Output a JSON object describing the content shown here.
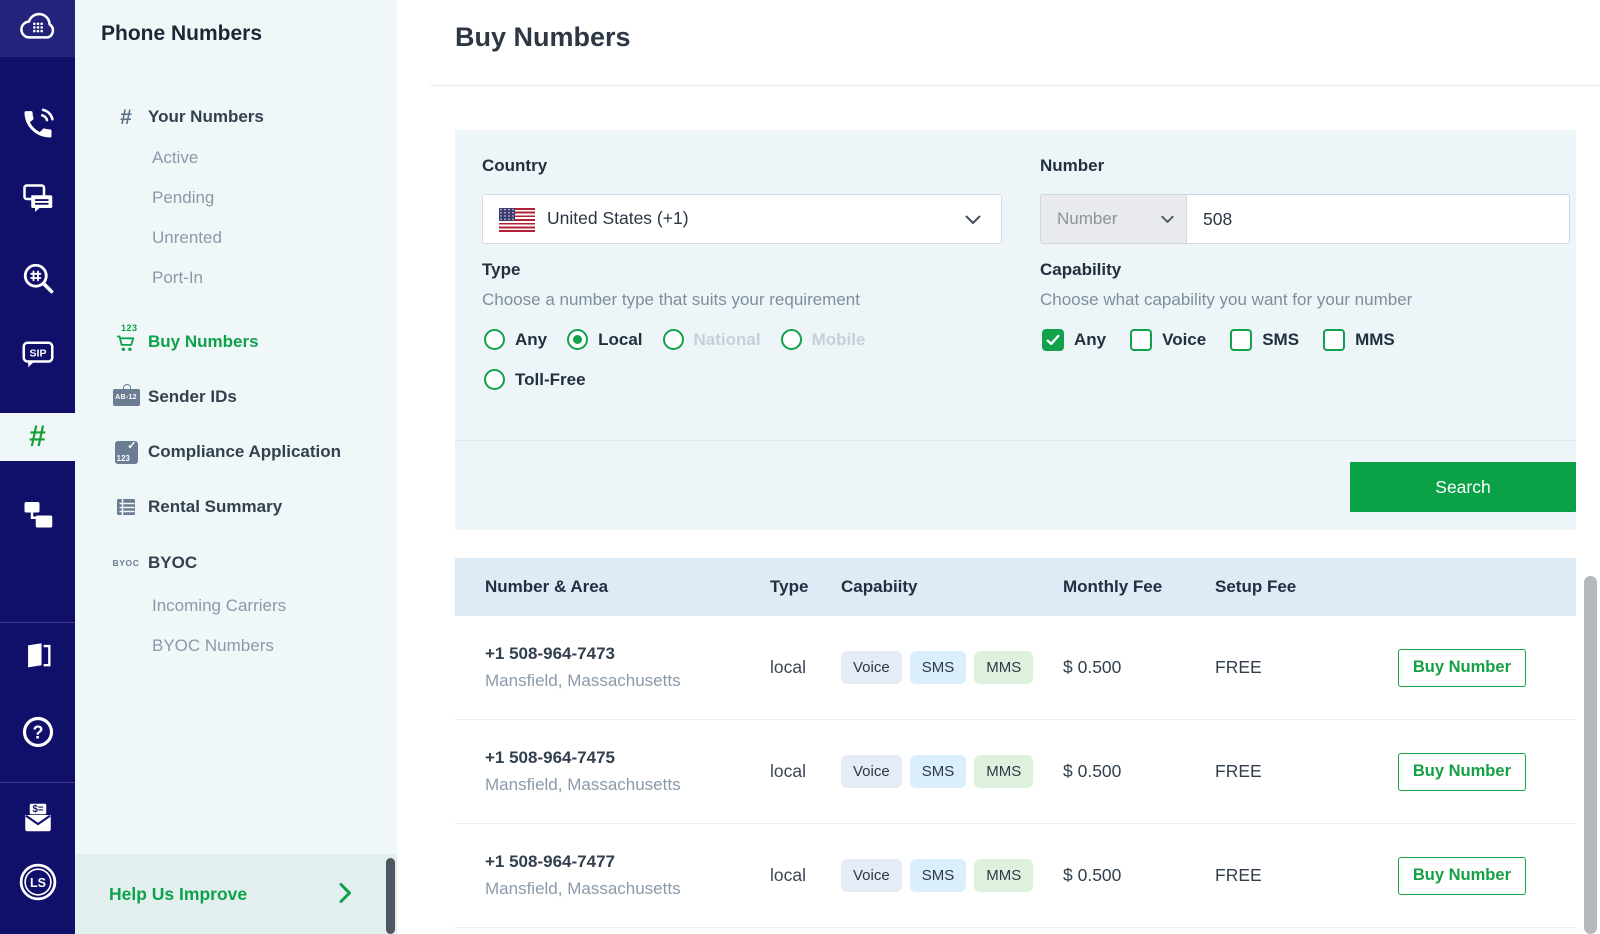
{
  "colors": {
    "navy": "#10106a",
    "green": "#0da24a",
    "header_bg": "#dcebf6",
    "card_bg": "#edf5f9"
  },
  "rail": {
    "active_hash": "#",
    "sip_label": "SIP",
    "avatar_label": "LS"
  },
  "sidebar": {
    "title": "Phone Numbers",
    "icon_labels": {
      "hash": "#",
      "cart_badge": "123",
      "sender_badge": "AB-12",
      "compliance_badge": "123",
      "compliance_check": "✓",
      "byoc_top": "BY",
      "byoc_bottom": "OC"
    },
    "items": {
      "your_numbers": "Your Numbers",
      "active": "Active",
      "pending": "Pending",
      "unrented": "Unrented",
      "port_in": "Port-In",
      "buy_numbers": "Buy Numbers",
      "sender_ids": "Sender IDs",
      "compliance": "Compliance Application",
      "rental": "Rental Summary",
      "byoc": "BYOC",
      "incoming_carriers": "Incoming Carriers",
      "byoc_numbers": "BYOC Numbers"
    },
    "help": "Help Us Improve"
  },
  "header": {
    "title": "Buy Numbers"
  },
  "filters": {
    "country": {
      "label": "Country",
      "value": "United States (+1)"
    },
    "number": {
      "label": "Number",
      "mode": "Number",
      "value": "508"
    },
    "type": {
      "label": "Type",
      "hint": "Choose a number type that suits your requirement",
      "options": [
        {
          "label": "Any",
          "state": "unselected"
        },
        {
          "label": "Local",
          "state": "selected"
        },
        {
          "label": "National",
          "state": "disabled"
        },
        {
          "label": "Mobile",
          "state": "disabled"
        },
        {
          "label": "Toll-Free",
          "state": "unselected"
        }
      ]
    },
    "capability": {
      "label": "Capability",
      "hint": "Choose what capability you want for your number",
      "options": [
        {
          "label": "Any",
          "checked": true
        },
        {
          "label": "Voice",
          "checked": false
        },
        {
          "label": "SMS",
          "checked": false
        },
        {
          "label": "MMS",
          "checked": false
        }
      ]
    },
    "search_label": "Search"
  },
  "table": {
    "headers": [
      "Number & Area",
      "Type",
      "Capabiity",
      "Monthly Fee",
      "Setup Fee"
    ],
    "buy_label": "Buy Number",
    "rows": [
      {
        "number": "+1 508-964-7473",
        "area": "Mansfield, Massachusetts",
        "type": "local",
        "capabilities": [
          "Voice",
          "SMS",
          "MMS"
        ],
        "monthly_fee": "$ 0.500",
        "setup_fee": "FREE"
      },
      {
        "number": "+1 508-964-7475",
        "area": "Mansfield, Massachusetts",
        "type": "local",
        "capabilities": [
          "Voice",
          "SMS",
          "MMS"
        ],
        "monthly_fee": "$ 0.500",
        "setup_fee": "FREE"
      },
      {
        "number": "+1 508-964-7477",
        "area": "Mansfield, Massachusetts",
        "type": "local",
        "capabilities": [
          "Voice",
          "SMS",
          "MMS"
        ],
        "monthly_fee": "$ 0.500",
        "setup_fee": "FREE"
      }
    ]
  }
}
